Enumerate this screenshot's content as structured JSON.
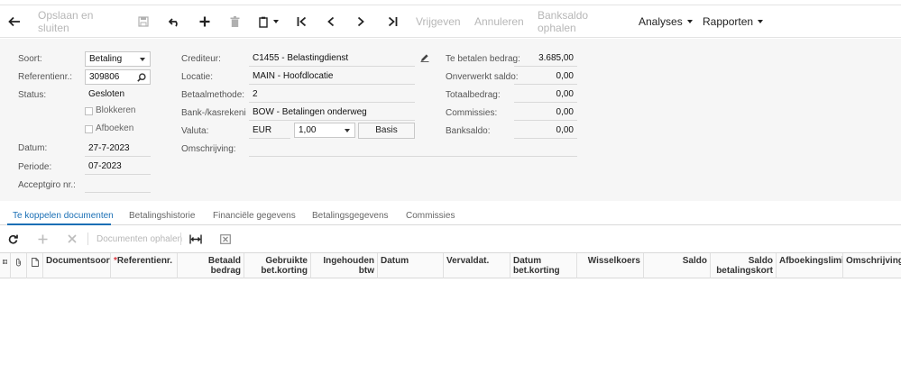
{
  "toolbar": {
    "save_close_label": "Opslaan en sluiten",
    "release_label": "Vrijgeven",
    "cancel_label": "Annuleren",
    "bank_balance_label": "Banksaldo ophalen",
    "analyses_label": "Analyses",
    "reports_label": "Rapporten"
  },
  "form": {
    "soort_label": "Soort:",
    "soort_value": "Betaling",
    "ref_label": "Referentienr.:",
    "ref_value": "309806",
    "status_label": "Status:",
    "status_value": "Gesloten",
    "blokkeren_label": "Blokkeren",
    "afboeken_label": "Afboeken",
    "datum_label": "Datum:",
    "datum_value": "27-7-2023",
    "periode_label": "Periode:",
    "periode_value": "07-2023",
    "acceptgiro_label": "Acceptgiro nr.:",
    "acceptgiro_value": "",
    "crediteur_label": "Crediteur:",
    "crediteur_value": "C1455 - Belastingdienst",
    "locatie_label": "Locatie:",
    "locatie_value": "MAIN - Hoofdlocatie",
    "betaalmethode_label": "Betaalmethode:",
    "betaalmethode_value": "2",
    "bank_label": "Bank-/kasrekeni...",
    "bank_value": "BOW - Betalingen onderweg",
    "valuta_label": "Valuta:",
    "valuta_value": "EUR",
    "rate_value": "1,00",
    "basis_label": "Basis",
    "omschrijving_label": "Omschrijving:",
    "omschrijving_value": "",
    "te_betalen_label": "Te betalen bedrag:",
    "te_betalen_value": "3.685,00",
    "onverwerkt_label": "Onverwerkt saldo:",
    "onverwerkt_value": "0,00",
    "totaal_label": "Totaalbedrag:",
    "totaal_value": "0,00",
    "commissies_label": "Commissies:",
    "commissies_value": "0,00",
    "banksaldo_label": "Banksaldo:",
    "banksaldo_value": "0,00"
  },
  "tabs": [
    {
      "label": "Te koppelen documenten"
    },
    {
      "label": "Betalingshistorie"
    },
    {
      "label": "Financiële gegevens"
    },
    {
      "label": "Betalingsgegevens"
    },
    {
      "label": "Commissies"
    }
  ],
  "grid_toolbar": {
    "load_documents_label": "Documenten ophalen"
  },
  "grid": {
    "columns": [
      {
        "label": "Documentsoort"
      },
      {
        "label": "Referentienr."
      },
      {
        "label": "Betaald bedrag"
      },
      {
        "label": "Gebruikte bet.korting"
      },
      {
        "label": "Ingehouden btw"
      },
      {
        "label": "Datum"
      },
      {
        "label": "Vervaldat."
      },
      {
        "label": "Datum bet.korting"
      },
      {
        "label": "Wisselkoers"
      },
      {
        "label": "Saldo"
      },
      {
        "label": "Saldo betalingskort"
      },
      {
        "label": "Afboekingslimiet"
      },
      {
        "label": "Omschrijving"
      }
    ]
  },
  "icons": {
    "back": "arrow-back-icon",
    "save": "save-icon",
    "undo": "undo-icon",
    "add": "plus-icon",
    "delete": "trash-icon",
    "copy": "copy-paste-icon",
    "first": "first-record-icon",
    "prev": "previous-record-icon",
    "next": "next-record-icon",
    "last": "last-record-icon",
    "search": "search-icon",
    "edit": "pencil-icon",
    "refresh": "refresh-icon",
    "fit": "fit-columns-icon",
    "export": "export-excel-icon"
  }
}
